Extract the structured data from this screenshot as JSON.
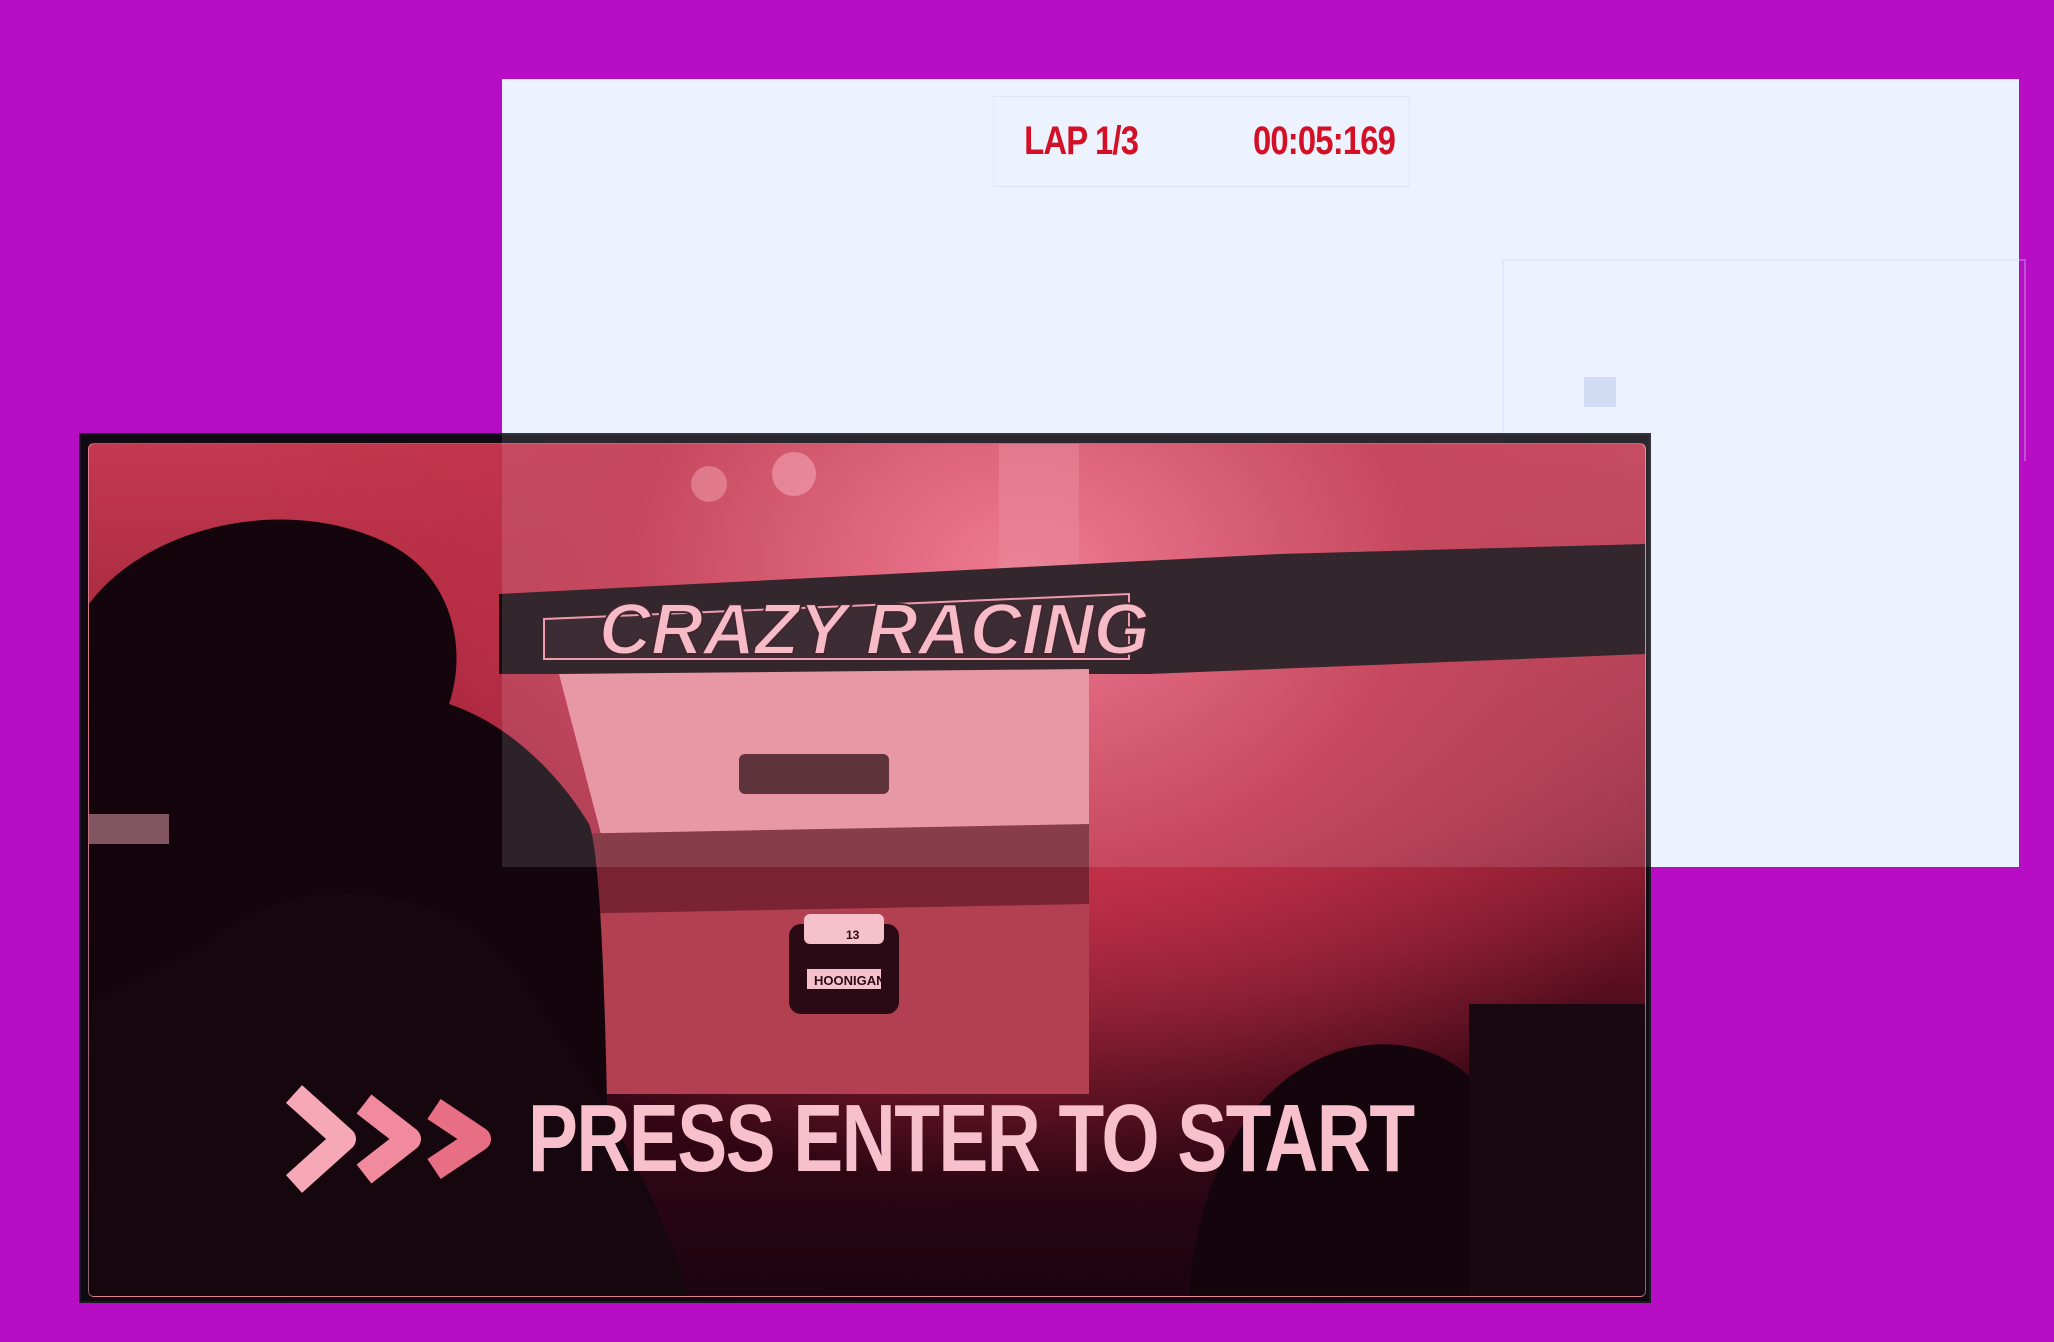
{
  "hud": {
    "lap": "LAP 1/3",
    "time": "00:05:169"
  },
  "start_screen": {
    "logo_text": "CRAZY RACING",
    "car_sponsor": "HOONIGAN",
    "car_number": "13",
    "prompt": "PRESS ENTER TO START"
  },
  "colors": {
    "background": "#b70dc4",
    "panel": "#ecf3fe",
    "hud_text": "#d31025",
    "prompt_text": "#f7c0cc"
  },
  "icons": {
    "prompt_arrows": "triple-chevron-right-icon"
  }
}
